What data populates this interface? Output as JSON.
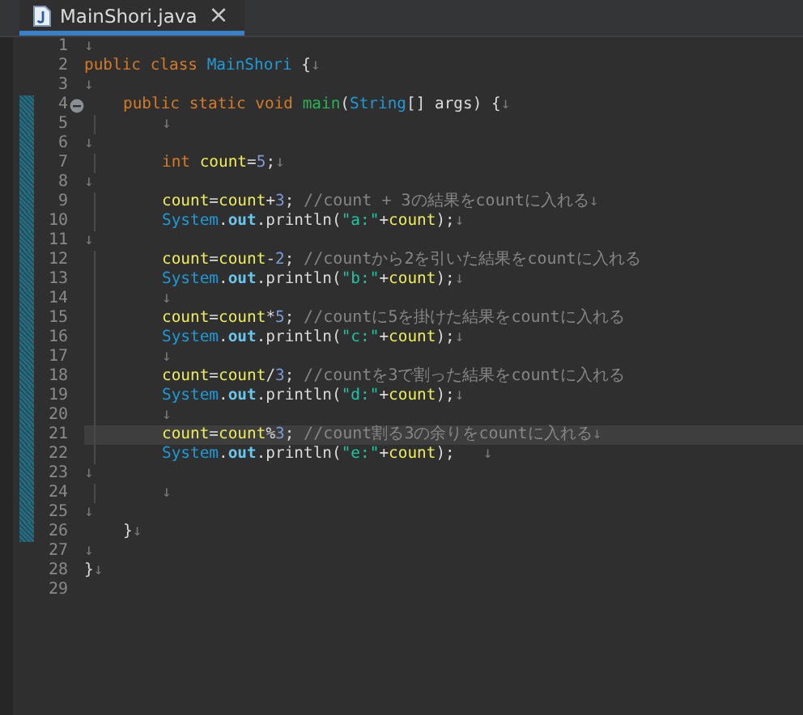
{
  "tab": {
    "title": "MainShori.java",
    "close": "×",
    "selected": true
  },
  "lines": [
    {
      "n": "1",
      "current": false,
      "changed": false,
      "tokens": [
        {
          "kind": "eol",
          "text": "↓"
        }
      ]
    },
    {
      "n": "2",
      "current": false,
      "changed": false,
      "tokens": [
        {
          "kind": "keyword",
          "text": "public class "
        },
        {
          "kind": "type",
          "text": "MainShori"
        },
        {
          "kind": "plain",
          "text": " {"
        },
        {
          "kind": "eol",
          "text": "↓"
        }
      ]
    },
    {
      "n": "3",
      "current": false,
      "changed": false,
      "tokens": [
        {
          "kind": "eol",
          "text": "↓"
        }
      ]
    },
    {
      "n": "4",
      "current": false,
      "changed": true,
      "fold": true,
      "tokens": [
        {
          "kind": "indent"
        },
        {
          "kind": "keyword",
          "text": "public static void "
        },
        {
          "kind": "method",
          "text": "main"
        },
        {
          "kind": "plain",
          "text": "("
        },
        {
          "kind": "type",
          "text": "String"
        },
        {
          "kind": "plain",
          "text": "[] args) {"
        },
        {
          "kind": "eol",
          "text": "↓"
        }
      ]
    },
    {
      "n": "5",
      "current": false,
      "changed": true,
      "tokens": [
        {
          "kind": "indent"
        },
        {
          "kind": "guide"
        },
        {
          "kind": "eol",
          "text": "↓"
        }
      ]
    },
    {
      "n": "6",
      "current": false,
      "changed": true,
      "tokens": [
        {
          "kind": "eol",
          "text": "↓"
        }
      ]
    },
    {
      "n": "7",
      "current": false,
      "changed": true,
      "tokens": [
        {
          "kind": "indent"
        },
        {
          "kind": "guide"
        },
        {
          "kind": "keyword",
          "text": "int "
        },
        {
          "kind": "variable",
          "text": "count"
        },
        {
          "kind": "plain",
          "text": "="
        },
        {
          "kind": "number",
          "text": "5"
        },
        {
          "kind": "plain",
          "text": ";"
        },
        {
          "kind": "eol",
          "text": "↓"
        }
      ]
    },
    {
      "n": "8",
      "current": false,
      "changed": true,
      "tokens": [
        {
          "kind": "eol",
          "text": "↓"
        }
      ]
    },
    {
      "n": "9",
      "current": false,
      "changed": true,
      "tokens": [
        {
          "kind": "indent"
        },
        {
          "kind": "guide"
        },
        {
          "kind": "variable",
          "text": "count"
        },
        {
          "kind": "plain",
          "text": "="
        },
        {
          "kind": "variable",
          "text": "count"
        },
        {
          "kind": "plain",
          "text": "+"
        },
        {
          "kind": "number",
          "text": "3"
        },
        {
          "kind": "plain",
          "text": "; "
        },
        {
          "kind": "comment",
          "text": "//count + 3の結果をcountに入れる"
        },
        {
          "kind": "eol",
          "text": "↓"
        }
      ]
    },
    {
      "n": "10",
      "current": false,
      "changed": true,
      "tokens": [
        {
          "kind": "indent"
        },
        {
          "kind": "guide"
        },
        {
          "kind": "type",
          "text": "System"
        },
        {
          "kind": "plain",
          "text": "."
        },
        {
          "kind": "field",
          "text": "out"
        },
        {
          "kind": "plain",
          "text": ".println("
        },
        {
          "kind": "string",
          "text": "\"a:\""
        },
        {
          "kind": "plain",
          "text": "+"
        },
        {
          "kind": "variable",
          "text": "count"
        },
        {
          "kind": "plain",
          "text": ");"
        },
        {
          "kind": "eol",
          "text": "↓"
        }
      ]
    },
    {
      "n": "11",
      "current": false,
      "changed": true,
      "tokens": [
        {
          "kind": "eol",
          "text": "↓"
        }
      ]
    },
    {
      "n": "12",
      "current": false,
      "changed": true,
      "tokens": [
        {
          "kind": "indent"
        },
        {
          "kind": "guide"
        },
        {
          "kind": "variable",
          "text": "count"
        },
        {
          "kind": "plain",
          "text": "="
        },
        {
          "kind": "variable",
          "text": "count"
        },
        {
          "kind": "plain",
          "text": "-"
        },
        {
          "kind": "number",
          "text": "2"
        },
        {
          "kind": "plain",
          "text": "; "
        },
        {
          "kind": "comment",
          "text": "//countから2を引いた結果をcountに入れる"
        }
      ]
    },
    {
      "n": "13",
      "current": false,
      "changed": true,
      "tokens": [
        {
          "kind": "indent"
        },
        {
          "kind": "guide"
        },
        {
          "kind": "type",
          "text": "System"
        },
        {
          "kind": "plain",
          "text": "."
        },
        {
          "kind": "field",
          "text": "out"
        },
        {
          "kind": "plain",
          "text": ".println("
        },
        {
          "kind": "string",
          "text": "\"b:\""
        },
        {
          "kind": "plain",
          "text": "+"
        },
        {
          "kind": "variable",
          "text": "count"
        },
        {
          "kind": "plain",
          "text": ");"
        },
        {
          "kind": "eol",
          "text": "↓"
        }
      ]
    },
    {
      "n": "14",
      "current": false,
      "changed": true,
      "tokens": [
        {
          "kind": "indent"
        },
        {
          "kind": "guide"
        },
        {
          "kind": "eol",
          "text": "↓"
        }
      ]
    },
    {
      "n": "15",
      "current": false,
      "changed": true,
      "tokens": [
        {
          "kind": "indent"
        },
        {
          "kind": "guide"
        },
        {
          "kind": "variable",
          "text": "count"
        },
        {
          "kind": "plain",
          "text": "="
        },
        {
          "kind": "variable",
          "text": "count"
        },
        {
          "kind": "plain",
          "text": "*"
        },
        {
          "kind": "number",
          "text": "5"
        },
        {
          "kind": "plain",
          "text": "; "
        },
        {
          "kind": "comment",
          "text": "//countに5を掛けた結果をcountに入れる"
        }
      ]
    },
    {
      "n": "16",
      "current": false,
      "changed": true,
      "tokens": [
        {
          "kind": "indent"
        },
        {
          "kind": "guide"
        },
        {
          "kind": "type",
          "text": "System"
        },
        {
          "kind": "plain",
          "text": "."
        },
        {
          "kind": "field",
          "text": "out"
        },
        {
          "kind": "plain",
          "text": ".println("
        },
        {
          "kind": "string",
          "text": "\"c:\""
        },
        {
          "kind": "plain",
          "text": "+"
        },
        {
          "kind": "variable",
          "text": "count"
        },
        {
          "kind": "plain",
          "text": ");"
        },
        {
          "kind": "eol",
          "text": "↓"
        }
      ]
    },
    {
      "n": "17",
      "current": false,
      "changed": true,
      "tokens": [
        {
          "kind": "indent"
        },
        {
          "kind": "guide"
        },
        {
          "kind": "eol",
          "text": "↓"
        }
      ]
    },
    {
      "n": "18",
      "current": false,
      "changed": true,
      "tokens": [
        {
          "kind": "indent"
        },
        {
          "kind": "guide"
        },
        {
          "kind": "variable",
          "text": "count"
        },
        {
          "kind": "plain",
          "text": "="
        },
        {
          "kind": "variable",
          "text": "count"
        },
        {
          "kind": "plain",
          "text": "/"
        },
        {
          "kind": "number",
          "text": "3"
        },
        {
          "kind": "plain",
          "text": "; "
        },
        {
          "kind": "comment",
          "text": "//countを3で割った結果をcountに入れる"
        }
      ]
    },
    {
      "n": "19",
      "current": false,
      "changed": true,
      "tokens": [
        {
          "kind": "indent"
        },
        {
          "kind": "guide"
        },
        {
          "kind": "type",
          "text": "System"
        },
        {
          "kind": "plain",
          "text": "."
        },
        {
          "kind": "field",
          "text": "out"
        },
        {
          "kind": "plain",
          "text": ".println("
        },
        {
          "kind": "string",
          "text": "\"d:\""
        },
        {
          "kind": "plain",
          "text": "+"
        },
        {
          "kind": "variable",
          "text": "count"
        },
        {
          "kind": "plain",
          "text": ");"
        },
        {
          "kind": "eol",
          "text": "↓"
        }
      ]
    },
    {
      "n": "20",
      "current": false,
      "changed": true,
      "tokens": [
        {
          "kind": "indent"
        },
        {
          "kind": "guide"
        },
        {
          "kind": "eol",
          "text": "↓"
        }
      ]
    },
    {
      "n": "21",
      "current": true,
      "changed": true,
      "tokens": [
        {
          "kind": "indent"
        },
        {
          "kind": "guide"
        },
        {
          "kind": "variable",
          "text": "count"
        },
        {
          "kind": "plain",
          "text": "="
        },
        {
          "kind": "variable",
          "text": "count"
        },
        {
          "kind": "plain",
          "text": "%"
        },
        {
          "kind": "number",
          "text": "3"
        },
        {
          "kind": "plain",
          "text": "; "
        },
        {
          "kind": "comment",
          "text": "//count割る3の余りをcountに入れる"
        },
        {
          "kind": "eol",
          "text": "↓"
        }
      ]
    },
    {
      "n": "22",
      "current": false,
      "changed": true,
      "tokens": [
        {
          "kind": "indent"
        },
        {
          "kind": "guide"
        },
        {
          "kind": "type",
          "text": "System"
        },
        {
          "kind": "plain",
          "text": "."
        },
        {
          "kind": "field",
          "text": "out"
        },
        {
          "kind": "plain",
          "text": ".println("
        },
        {
          "kind": "string",
          "text": "\"e:\""
        },
        {
          "kind": "plain",
          "text": "+"
        },
        {
          "kind": "variable",
          "text": "count"
        },
        {
          "kind": "plain",
          "text": ");"
        },
        {
          "kind": "eol",
          "text": "   ↓"
        }
      ]
    },
    {
      "n": "23",
      "current": false,
      "changed": true,
      "tokens": [
        {
          "kind": "eol",
          "text": "↓"
        }
      ]
    },
    {
      "n": "24",
      "current": false,
      "changed": true,
      "tokens": [
        {
          "kind": "indent"
        },
        {
          "kind": "guide"
        },
        {
          "kind": "eol",
          "text": "↓"
        }
      ]
    },
    {
      "n": "25",
      "current": false,
      "changed": true,
      "tokens": [
        {
          "kind": "eol",
          "text": "↓"
        }
      ]
    },
    {
      "n": "26",
      "current": false,
      "changed": true,
      "tokens": [
        {
          "kind": "indent"
        },
        {
          "kind": "plain",
          "text": "}"
        },
        {
          "kind": "eol",
          "text": "↓"
        }
      ]
    },
    {
      "n": "27",
      "current": false,
      "changed": false,
      "tokens": [
        {
          "kind": "eol",
          "text": "↓"
        }
      ]
    },
    {
      "n": "28",
      "current": false,
      "changed": false,
      "tokens": [
        {
          "kind": "plain",
          "text": "}"
        },
        {
          "kind": "eol",
          "text": "↓"
        }
      ]
    },
    {
      "n": "29",
      "current": false,
      "changed": false
    }
  ]
}
